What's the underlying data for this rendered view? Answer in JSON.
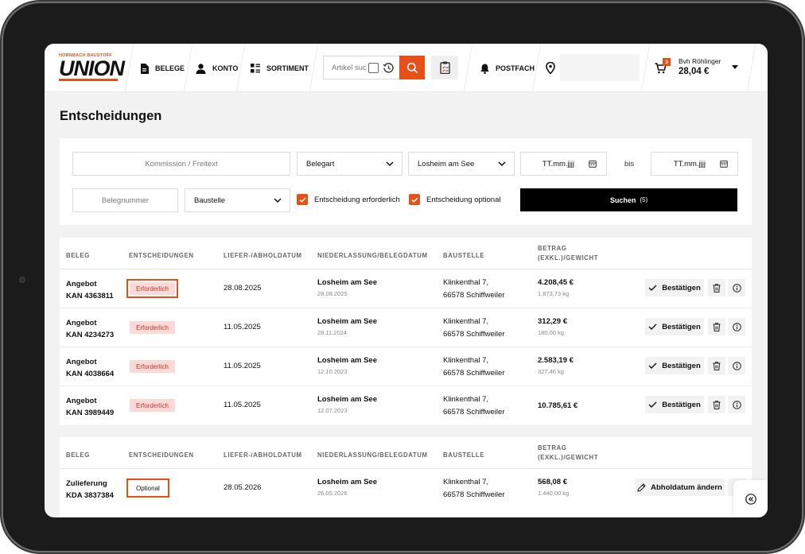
{
  "brand": {
    "tagline": "HORNBACH BAUSTOFF",
    "name": "UNION",
    "accent": "#e8501a"
  },
  "nav": {
    "belege": "BELEGE",
    "konto": "KONTO",
    "sortiment": "SORTIMENT",
    "postfach": "POSTFACH"
  },
  "search": {
    "placeholder": "Artikel suchen"
  },
  "cart": {
    "count": "3"
  },
  "user": {
    "name": "Bvh Röhlinger",
    "amount": "28,04 €"
  },
  "page": {
    "title": "Entscheidungen"
  },
  "filters": {
    "kommission_placeholder": "Kommission / Freitext",
    "belegart": "Belegart",
    "niederlassung": "Losheim am See",
    "date_from": "TT.mm.jjjj",
    "bis": "bis",
    "date_to": "TT.mm.jjjj",
    "belegnummer_placeholder": "Belegnummer",
    "baustelle": "Baustelle",
    "check_required": "Entscheidung erforderlich",
    "check_optional": "Entscheidung optional",
    "search_button": "Suchen",
    "search_count": "(5)"
  },
  "columns": {
    "beleg": "BELEG",
    "entscheidungen": "ENTSCHEIDUNGEN",
    "datum": "LIEFER-/ABHOLDATUM",
    "niederlassung": "NIEDERLASSUNG/BELEGDATUM",
    "baustelle": "BAUSTELLE",
    "betrag1": "BETRAG",
    "betrag2": "(EXKL.)/GEWICHT"
  },
  "table1": {
    "rows": [
      {
        "type": "Angebot",
        "number": "KAN 4363811",
        "status": "Erforderlich",
        "date": "28.08.2025",
        "branch": "Losheim am See",
        "doc_date": "28.08.2025",
        "street": "Klinkenthal 7,",
        "city": "66578 Schiffweiler",
        "amount": "4.208,45 €",
        "weight": "1.873,73 kg",
        "action": "Bestätigen"
      },
      {
        "type": "Angebot",
        "number": "KAN 4234273",
        "status": "Erforderlich",
        "date": "11.05.2025",
        "branch": "Losheim am See",
        "doc_date": "28.11.2024",
        "street": "Klinkenthal 7,",
        "city": "66578 Schiffweiler",
        "amount": "312,29 €",
        "weight": "180,00 kg",
        "action": "Bestätigen"
      },
      {
        "type": "Angebot",
        "number": "KAN 4038664",
        "status": "Erforderlich",
        "date": "11.05.2025",
        "branch": "Losheim am See",
        "doc_date": "12.10.2023",
        "street": "Klinkenthal 7,",
        "city": "66578 Schiffweiler",
        "amount": "2.583,19 €",
        "weight": "327,46 kg",
        "action": "Bestätigen"
      },
      {
        "type": "Angebot",
        "number": "KAN 3989449",
        "status": "Erforderlich",
        "date": "11.05.2025",
        "branch": "Losheim am See",
        "doc_date": "12.07.2023",
        "street": "Klinkenthal 7,",
        "city": "66578 Schiffweiler",
        "amount": "10.785,61 €",
        "action": "Bestätigen"
      }
    ]
  },
  "table2": {
    "rows": [
      {
        "type": "Zulieferung",
        "number": "KDA 3837384",
        "status": "Optional",
        "date": "28.05.2026",
        "branch": "Losheim am See",
        "doc_date": "26.05.2026",
        "street": "Klinkenthal 7,",
        "city": "66578 Schiffweiler",
        "amount": "568,08 €",
        "weight": "1.440,00 kg",
        "action": "Abholdatum ändern"
      }
    ]
  }
}
